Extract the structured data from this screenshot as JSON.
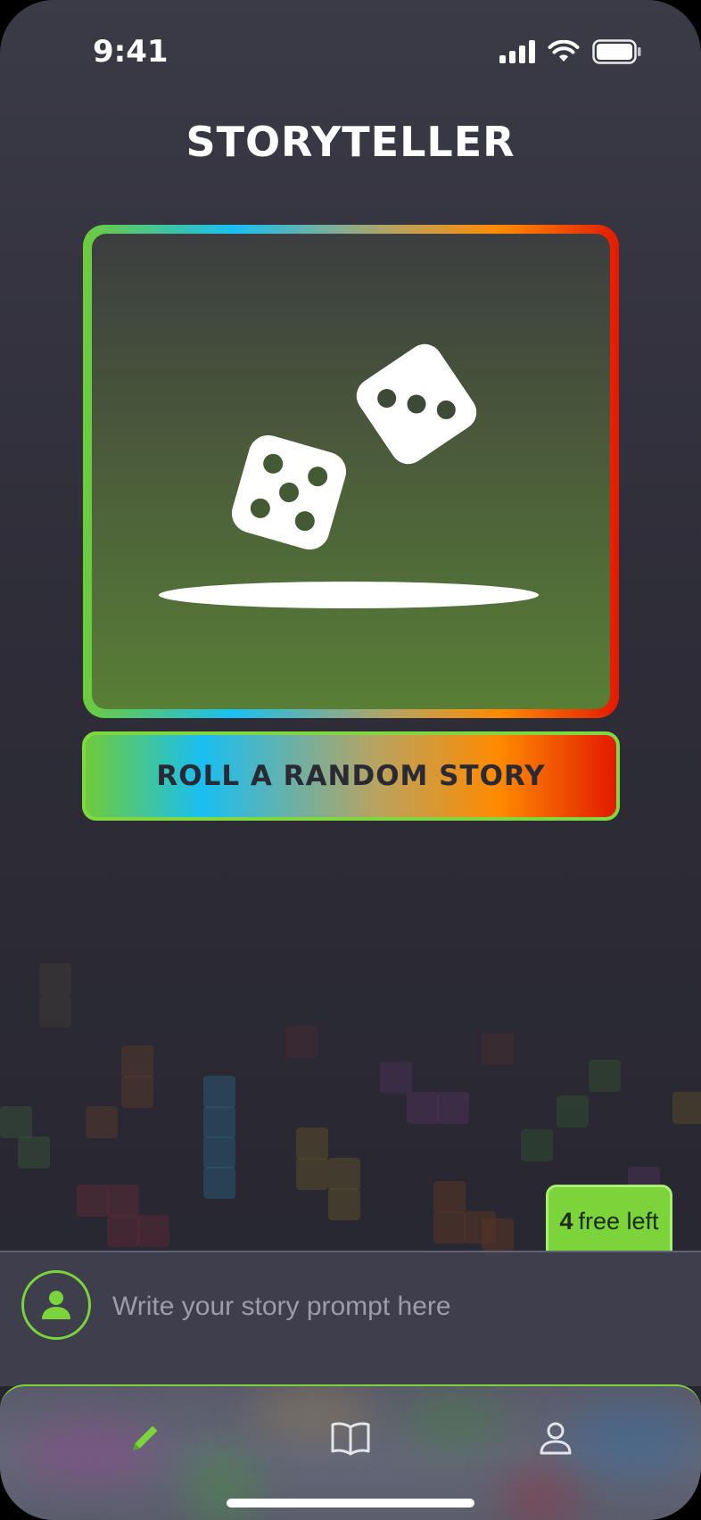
{
  "status_bar": {
    "time": "9:41",
    "icons": [
      "cellular-signal-icon",
      "wifi-icon",
      "battery-icon"
    ]
  },
  "header": {
    "title": "STORYTELLER"
  },
  "hero": {
    "image": "dice-icon"
  },
  "actions": {
    "roll_label": "ROLL A RANDOM STORY"
  },
  "badge": {
    "count": "4",
    "label": "free left"
  },
  "prompt": {
    "placeholder": "Write your story prompt here",
    "value": ""
  },
  "tabs": [
    {
      "name": "write",
      "icon": "pencil-icon",
      "active": true
    },
    {
      "name": "library",
      "icon": "book-icon",
      "active": false
    },
    {
      "name": "profile",
      "icon": "person-icon",
      "active": false
    }
  ],
  "colors": {
    "accent": "#7ad43a",
    "gradient": [
      "#6fcb3a",
      "#19bff2",
      "#b9a35f",
      "#ff8a00",
      "#e21a00"
    ],
    "background": "#2e2d38",
    "prompt_bar": "#3f3e4c"
  }
}
